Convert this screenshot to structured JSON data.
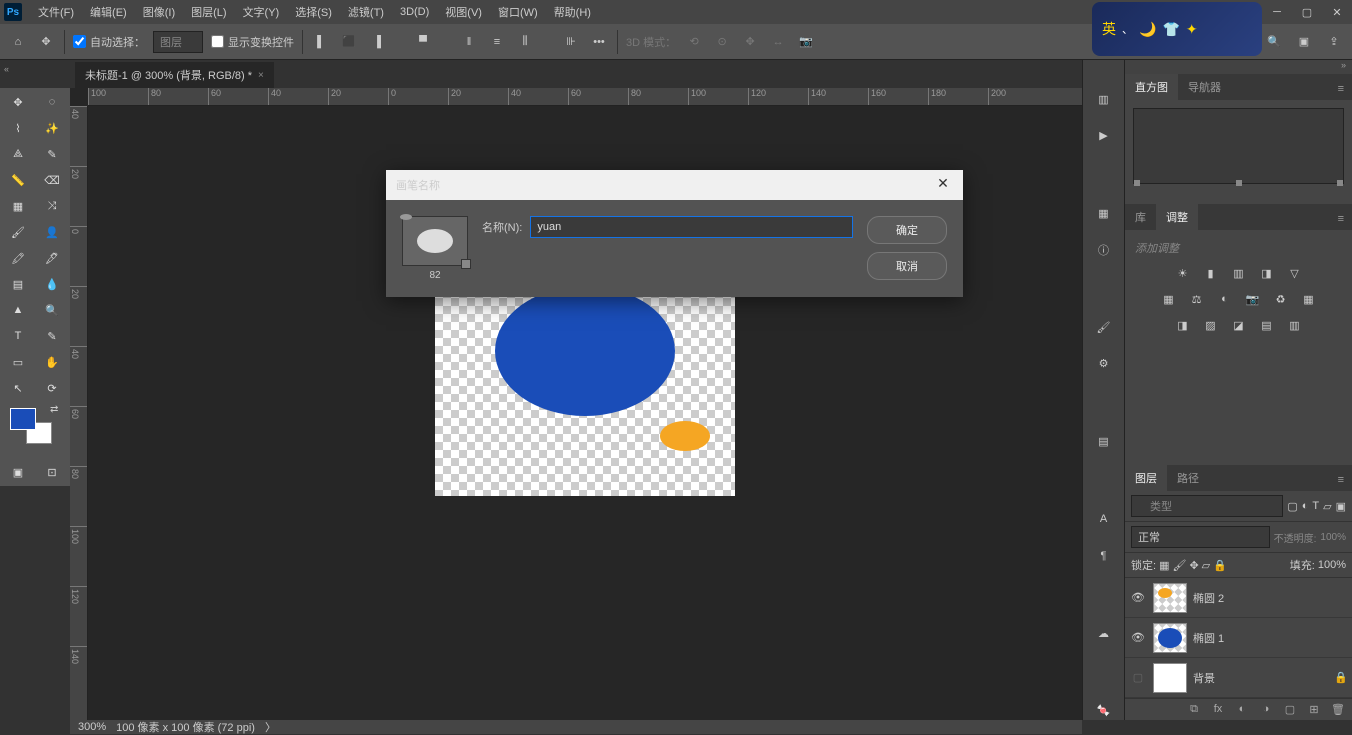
{
  "menu": [
    "文件(F)",
    "编辑(E)",
    "图像(I)",
    "图层(L)",
    "文字(Y)",
    "选择(S)",
    "滤镜(T)",
    "3D(D)",
    "视图(V)",
    "窗口(W)",
    "帮助(H)"
  ],
  "optbar": {
    "auto_select": "自动选择：",
    "layer_sel": "图层",
    "show_transform": "显示变换控件",
    "mode_3d": "3D 模式："
  },
  "ime": "英",
  "tab": {
    "title": "未标题-1 @ 300% (背景, RGB/8) *"
  },
  "ruler_h": [
    "100",
    "80",
    "60",
    "40",
    "20",
    "0",
    "20",
    "40",
    "60",
    "80",
    "100",
    "120",
    "140",
    "160",
    "180",
    "200"
  ],
  "ruler_v": [
    "40",
    "20",
    "0",
    "20",
    "40",
    "60",
    "80",
    "100",
    "120",
    "140"
  ],
  "panels": {
    "histo_tab": "直方图",
    "nav_tab": "导航器",
    "lib_tab": "库",
    "adj_tab": "调整",
    "adj_title": "添加调整",
    "layers_tab": "图层",
    "paths_tab": "路径",
    "kind": "类型",
    "blend": "正常",
    "opacity_lbl": "不透明度:",
    "opacity": "100%",
    "lock_lbl": "锁定:",
    "fill_lbl": "填充:",
    "fill": "100%",
    "layers": [
      {
        "name": "椭圆 2",
        "thumb": "orange"
      },
      {
        "name": "椭圆 1",
        "thumb": "blue"
      },
      {
        "name": "背景",
        "thumb": "white",
        "locked": true
      }
    ]
  },
  "status": {
    "zoom": "300%",
    "doc": "100 像素 x 100 像素 (72 ppi)"
  },
  "dialog": {
    "title": "画笔名称",
    "name_label": "名称(N):",
    "value": "yuan",
    "size": "82",
    "ok": "确定",
    "cancel": "取消"
  }
}
